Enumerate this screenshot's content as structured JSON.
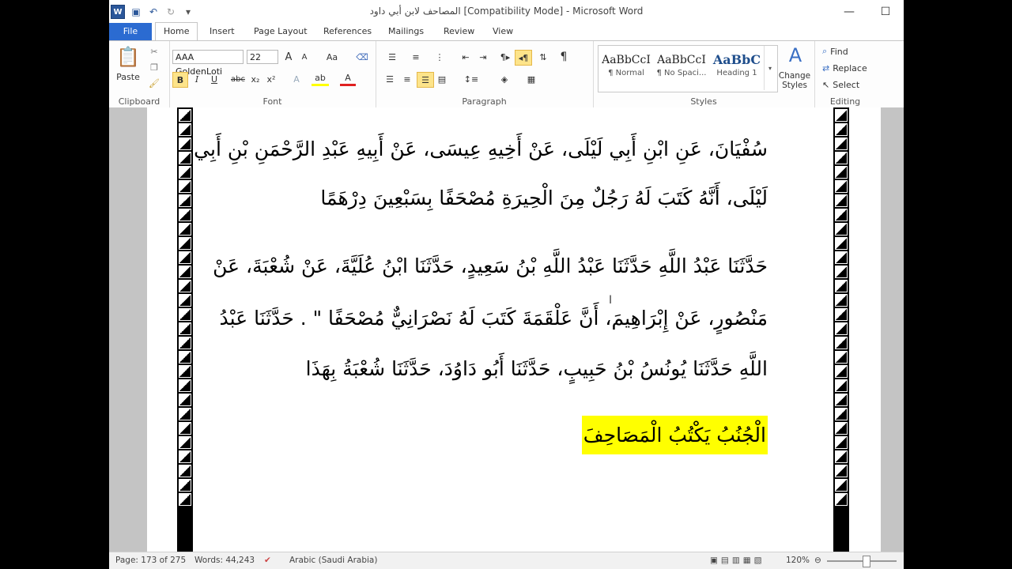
{
  "title_bar": {
    "title": "المصاحف لابن أبي داود [Compatibility Mode]  -  Microsoft Word",
    "minimize": "—",
    "maximize": "☐"
  },
  "tabs": [
    "File",
    "Home",
    "Insert",
    "Page Layout",
    "References",
    "Mailings",
    "Review",
    "View"
  ],
  "active_tab": "Home",
  "clipboard": {
    "paste_label": "Paste",
    "group_label": "Clipboard"
  },
  "font": {
    "family": "AAA GoldenLoti",
    "size": "22",
    "group_label": "Font"
  },
  "paragraph": {
    "group_label": "Paragraph"
  },
  "styles": {
    "items": [
      {
        "preview": "AaBbCcI",
        "name": "¶ Normal"
      },
      {
        "preview": "AaBbCcI",
        "name": "¶ No Spaci..."
      },
      {
        "preview": "AaBbC",
        "name": "Heading 1"
      }
    ],
    "change_styles": "Change Styles",
    "group_label": "Styles"
  },
  "editing": {
    "find": "Find",
    "replace": "Replace",
    "select": "Select",
    "group_label": "Editing"
  },
  "document": {
    "lines": [
      "سُفْيَانَ، عَنِ ابْنِ أَبِي لَيْلَى، عَنْ أَخِيهِ عِيسَى، عَنْ أَبِيهِ عَبْدِ الرَّحْمَنِ بْنِ أَبِي",
      "لَيْلَى، أَنَّهُ كَتَبَ لَهُ رَجُلٌ مِنَ الْحِيرَةِ مُصْحَفًا بِسَبْعِينَ دِرْهَمًا",
      "حَدَّثَنَا عَبْدُ اللَّهِ حَدَّثَنَا عَبْدُ اللَّهِ بْنُ سَعِيدٍ، حَدَّثَنَا ابْنُ عُلَيَّةَ، عَنْ شُعْبَةَ، عَنْ",
      "مَنْصُورٍ، عَنْ إِبْرَاهِيمَ، أَنَّ عَلْقَمَةَ كَتَبَ لَهُ نَصْرَانِيٌّ مُصْحَفًا \" . حَدَّثَنَا عَبْدُ",
      "اللَّهِ حَدَّثَنَا يُونُسُ بْنُ حَبِيبٍ، حَدَّثَنَا أَبُو دَاوُدَ، حَدَّثَنَا شُعْبَةُ بِهَذَا"
    ],
    "heading": "الْجُنُبُ يَكْتُبُ الْمَصَاحِفَ"
  },
  "status": {
    "page": "Page: 173 of 275",
    "words": "Words: 44,243",
    "language": "Arabic (Saudi Arabia)",
    "zoom": "120%"
  },
  "colors": {
    "accent": "#2b579a",
    "file_tab": "#2b6bd1",
    "highlight": "#ffff00"
  }
}
